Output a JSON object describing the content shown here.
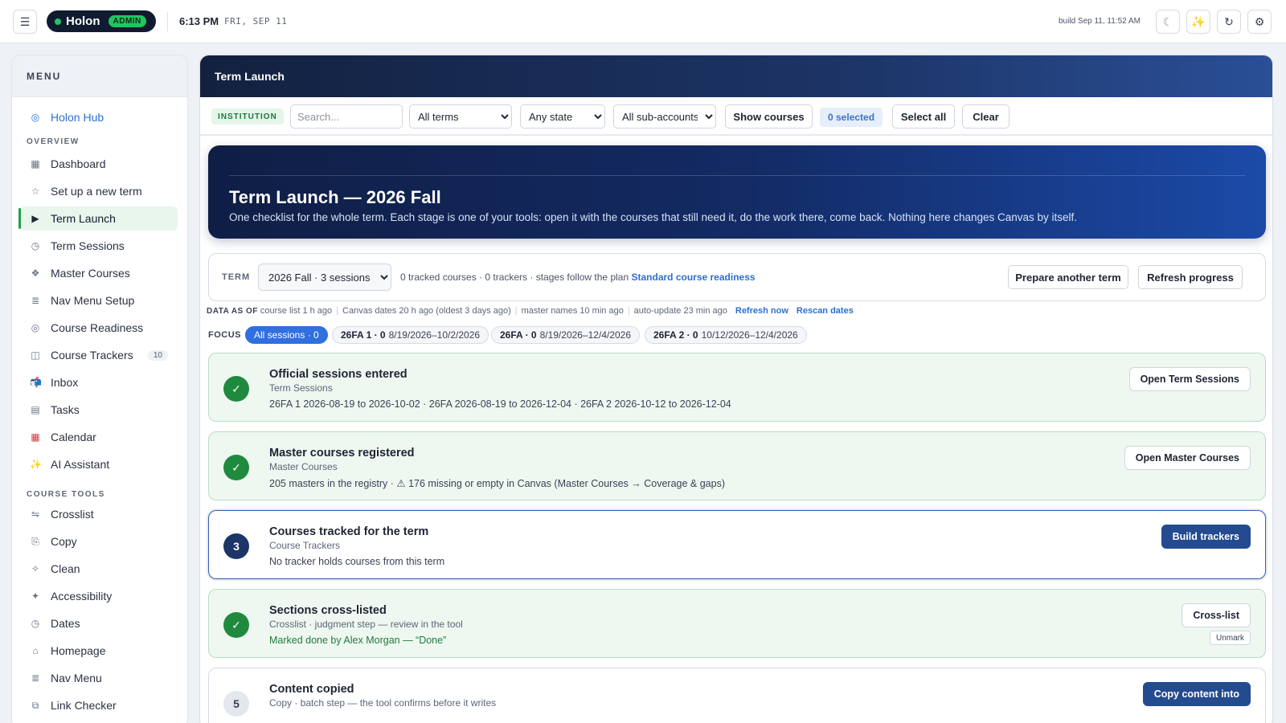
{
  "topbar": {
    "menu_icon": "hamburger-icon",
    "brand": "Holon",
    "badge": "ADMIN",
    "time": "6:13 PM",
    "date": "FRI, SEP 11",
    "build": "build Sep 11, 11:52 AM",
    "icons": [
      "moon-icon",
      "sparkles-icon",
      "refresh-icon",
      "gear-icon"
    ]
  },
  "sidebar": {
    "title": "MENU",
    "hub": "Holon Hub",
    "section_overview": "OVERVIEW",
    "overview": [
      {
        "label": "Dashboard",
        "icon": "grid-icon"
      },
      {
        "label": "Set up a new term",
        "icon": "star-icon"
      },
      {
        "label": "Term Launch",
        "icon": "play-icon",
        "active": true
      },
      {
        "label": "Term Sessions",
        "icon": "clock-icon"
      },
      {
        "label": "Master Courses",
        "icon": "diamond-icon"
      },
      {
        "label": "Nav Menu Setup",
        "icon": "list-icon"
      },
      {
        "label": "Course Readiness",
        "icon": "target-icon"
      },
      {
        "label": "Course Trackers",
        "icon": "columns-icon",
        "count": "10"
      },
      {
        "label": "Inbox",
        "icon": "mailbox-icon"
      },
      {
        "label": "Tasks",
        "icon": "tasks-icon"
      },
      {
        "label": "Calendar",
        "icon": "calendar-icon"
      },
      {
        "label": "AI Assistant",
        "icon": "sparkles-icon"
      }
    ],
    "section_tools": "COURSE TOOLS",
    "tools": [
      {
        "label": "Crosslist",
        "icon": "arrows-icon"
      },
      {
        "label": "Copy",
        "icon": "copy-icon"
      },
      {
        "label": "Clean",
        "icon": "sparkle-icon"
      },
      {
        "label": "Accessibility",
        "icon": "accessibility-icon"
      },
      {
        "label": "Dates",
        "icon": "clock-icon"
      },
      {
        "label": "Homepage",
        "icon": "home-icon"
      },
      {
        "label": "Nav Menu",
        "icon": "list-icon"
      },
      {
        "label": "Link Checker",
        "icon": "link-icon"
      }
    ]
  },
  "main": {
    "title": "Term Launch",
    "filters": {
      "institution": "INSTITUTION",
      "search_placeholder": "Search...",
      "terms": "All terms",
      "state": "Any state",
      "subaccounts": "All sub-accounts",
      "show_courses": "Show courses",
      "selected": "0 selected",
      "select_all": "Select all",
      "clear": "Clear"
    },
    "hero": {
      "title": "Term Launch — 2026 Fall",
      "subtitle": "One checklist for the whole term. Each stage is one of your tools: open it with the courses that still need it, do the work there, come back. Nothing here changes Canvas by itself."
    },
    "term": {
      "label": "TERM",
      "selected": "2026 Fall · 3 sessions",
      "meta": "0 tracked courses · 0 trackers · stages follow the plan",
      "plan_link": "Standard course readiness",
      "prepare_btn": "Prepare another term",
      "refresh_btn": "Refresh progress"
    },
    "asof": {
      "label": "DATA AS OF",
      "items": [
        "course list 1 h ago",
        "Canvas dates 20 h ago (oldest 3 days ago)",
        "master names 10 min ago",
        "auto-update 23 min ago"
      ],
      "refresh": "Refresh now",
      "rescan": "Rescan dates"
    },
    "focus": {
      "label": "FOCUS",
      "all": "All sessions · 0",
      "sessions": [
        {
          "name": "26FA 1 · 0",
          "range": "8/19/2026–10/2/2026"
        },
        {
          "name": "26FA · 0",
          "range": "8/19/2026–12/4/2026"
        },
        {
          "name": "26FA 2 · 0",
          "range": "10/12/2026–12/4/2026"
        }
      ]
    },
    "stages": [
      {
        "badge": "✓",
        "title": "Official sessions entered",
        "tool": "Term Sessions",
        "detail": "26FA 1 2026-08-19 to 2026-10-02 · 26FA 2026-08-19 to 2026-12-04 · 26FA 2 2026-10-12 to 2026-12-04",
        "button": "Open Term Sessions"
      },
      {
        "badge": "✓",
        "title": "Master courses registered",
        "tool": "Master Courses",
        "detail": "205 masters in the registry · ⚠ 176 missing or empty in Canvas (Master Courses → Coverage & gaps)",
        "button": "Open Master Courses"
      },
      {
        "badge": "3",
        "title": "Courses tracked for the term",
        "tool": "Course Trackers",
        "detail": "No tracker holds courses from this term",
        "button": "Build trackers"
      },
      {
        "badge": "✓",
        "title": "Sections cross-listed",
        "tool": "Crosslist · judgment step — review in the tool",
        "detail": "Marked done by Alex Morgan — “Done”",
        "button": "Cross-list",
        "unmark": "Unmark"
      },
      {
        "badge": "5",
        "title": "Content copied",
        "tool": "Copy · batch step — the tool confirms before it writes",
        "detail": "",
        "button": "Copy content into"
      }
    ]
  }
}
